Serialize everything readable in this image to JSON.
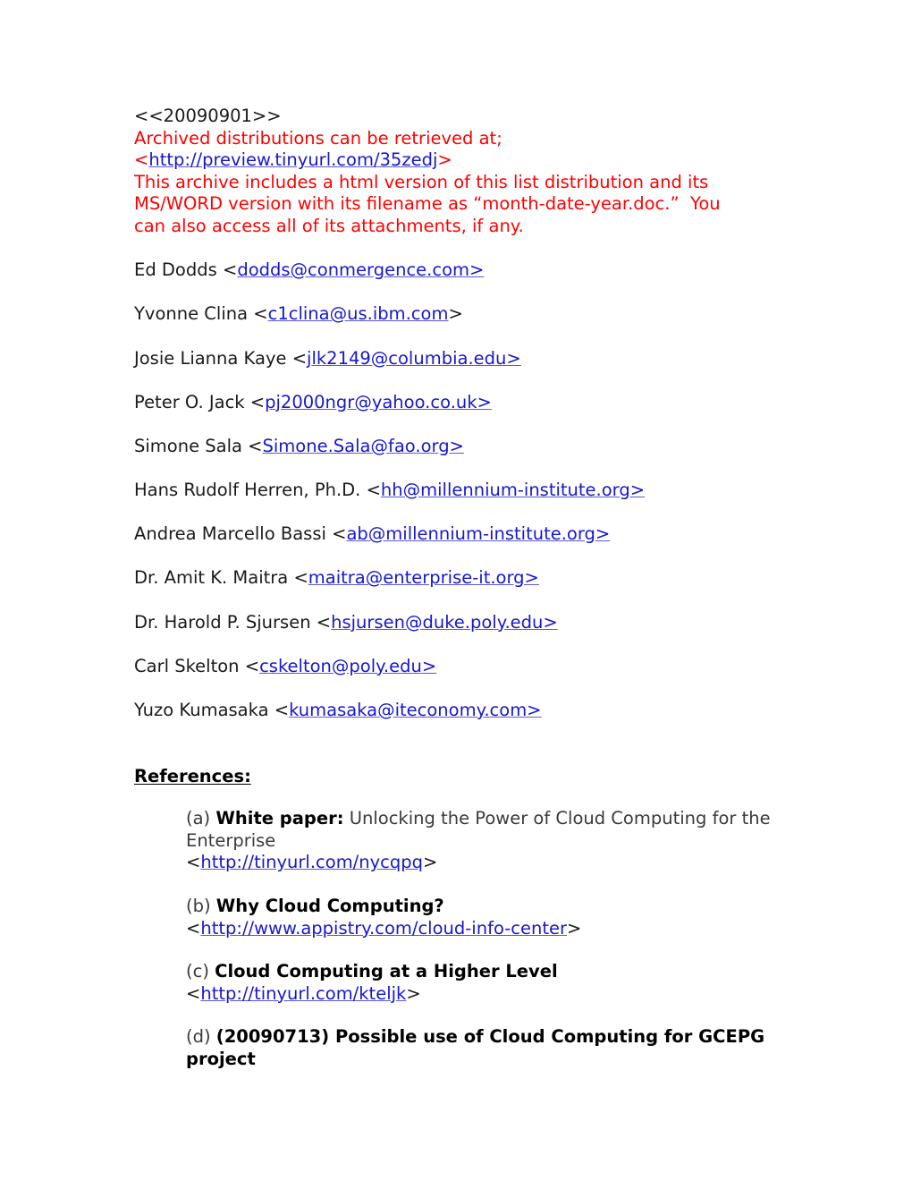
{
  "document": {
    "header": {
      "date_tag": "<<20090901>>",
      "archive_notice": "Archived distributions can be retrieved at;",
      "archive_url_open_bracket": "<",
      "archive_url": "http://preview.tinyurl.com/35zedj",
      "archive_url_close_bracket": ">",
      "archive_description_line1": "This archive includes a html version of this list distribution and its",
      "archive_description_line2": "MS/WORD version with its filename as “month-date-year.doc.”  You",
      "archive_description_line3": "can also access all of its attachments, if any."
    },
    "contacts": [
      {
        "name": "Ed Dodds ",
        "open_bracket": "<",
        "email": "dodds@conmergence.com>",
        "close_bracket": "",
        "bracket_inside_link": true
      },
      {
        "name": "Yvonne Clina ",
        "open_bracket": "<",
        "email": "c1clina@us.ibm.com",
        "close_bracket": ">",
        "bracket_inside_link": false
      },
      {
        "name": "Josie Lianna Kaye ",
        "open_bracket": "<",
        "email": "jlk2149@columbia.edu>",
        "close_bracket": "",
        "bracket_inside_link": true
      },
      {
        "name": "Peter O. Jack ",
        "open_bracket": "<",
        "email": "pj2000ngr@yahoo.co.uk>",
        "close_bracket": "",
        "bracket_inside_link": true
      },
      {
        "name": "Simone Sala ",
        "open_bracket": "<",
        "email": "Simone.Sala@fao.org>",
        "close_bracket": "",
        "bracket_inside_link": true
      },
      {
        "name": "Hans Rudolf Herren, Ph.D. ",
        "open_bracket": "<",
        "email": "hh@millennium-institute.org>",
        "close_bracket": "",
        "bracket_inside_link": true
      },
      {
        "name": "Andrea Marcello Bassi ",
        "open_bracket": "<",
        "email": "ab@millennium-institute.org>",
        "close_bracket": "",
        "bracket_inside_link": true
      },
      {
        "name": "Dr. Amit K. Maitra ",
        "open_bracket": "<",
        "email": "maitra@enterprise-it.org>",
        "close_bracket": "",
        "bracket_inside_link": true
      },
      {
        "name": "Dr. Harold P. Sjursen ",
        "open_bracket": "<",
        "email": "hsjursen@duke.poly.edu>",
        "close_bracket": "",
        "bracket_inside_link": true
      },
      {
        "name": "Carl Skelton ",
        "open_bracket": "<",
        "email": "cskelton@poly.edu>",
        "close_bracket": "",
        "bracket_inside_link": true
      },
      {
        "name": "Yuzo Kumasaka ",
        "open_bracket": "<",
        "email": "kumasaka@iteconomy.com>",
        "close_bracket": "",
        "bracket_inside_link": true
      }
    ],
    "references": {
      "heading": "References:",
      "items": [
        {
          "marker": "(a) ",
          "title_bold": "White paper:",
          "body": " Unlocking the Power of Cloud Computing for the Enterprise",
          "url_open_bracket": "<",
          "url": "http://tinyurl.com/nycqpq",
          "url_close_bracket": ">"
        },
        {
          "marker": "(b) ",
          "title_bold": "Why Cloud Computing?",
          "body": "",
          "url_open_bracket": "<",
          "url": "http://www.appistry.com/cloud-info-center",
          "url_close_bracket": ">"
        },
        {
          "marker": "(c) ",
          "title_bold": "Cloud Computing at a Higher Level",
          "body": "",
          "url_open_bracket": "<",
          "url": "http://tinyurl.com/kteljk",
          "url_close_bracket": ">"
        },
        {
          "marker": "(d) ",
          "title_bold": "(20090713) Possible use of Cloud Computing for GCEPG project",
          "body": "",
          "url_open_bracket": "",
          "url": "",
          "url_close_bracket": ""
        }
      ]
    },
    "colors": {
      "red_text": "#ff0000",
      "link_blue": "#1717cf",
      "body_black": "#1a1a1a",
      "body_gray": "#3a3a3a",
      "page_background": "#ffffff"
    }
  }
}
